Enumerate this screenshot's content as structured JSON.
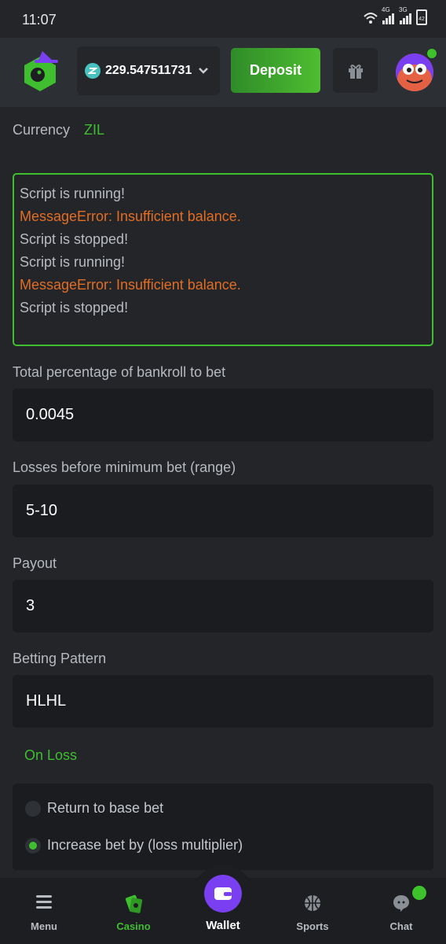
{
  "status_bar": {
    "time": "11:07",
    "network_1": "4G",
    "network_2": "3G",
    "battery": "42"
  },
  "header": {
    "balance": "229.547511731",
    "deposit_label": "Deposit",
    "colors": {
      "accent": "#3fbe30",
      "deposit": "#4ebd30",
      "zil": "#49c1bf"
    }
  },
  "currency": {
    "label": "Currency",
    "value": "ZIL"
  },
  "log": [
    {
      "text": "Script is running!",
      "type": "info"
    },
    {
      "text": "MessageError: Insufficient balance.",
      "type": "error"
    },
    {
      "text": "Script is stopped!",
      "type": "info"
    },
    {
      "text": "Script is running!",
      "type": "info"
    },
    {
      "text": "MessageError: Insufficient balance.",
      "type": "error"
    },
    {
      "text": "Script is stopped!",
      "type": "info"
    }
  ],
  "fields": {
    "bankroll": {
      "label": "Total percentage of bankroll to bet",
      "value": "0.0045"
    },
    "losses": {
      "label": "Losses before minimum bet (range)",
      "value": "5-10"
    },
    "payout": {
      "label": "Payout",
      "value": "3"
    },
    "pattern": {
      "label": "Betting Pattern",
      "value": "HLHL"
    }
  },
  "on_loss": {
    "title": "On Loss",
    "options": [
      {
        "label": "Return to base bet",
        "selected": false
      },
      {
        "label": "Increase bet by (loss multiplier)",
        "selected": true
      }
    ]
  },
  "nav": {
    "menu": "Menu",
    "casino": "Casino",
    "wallet": "Wallet",
    "sports": "Sports",
    "chat": "Chat"
  }
}
